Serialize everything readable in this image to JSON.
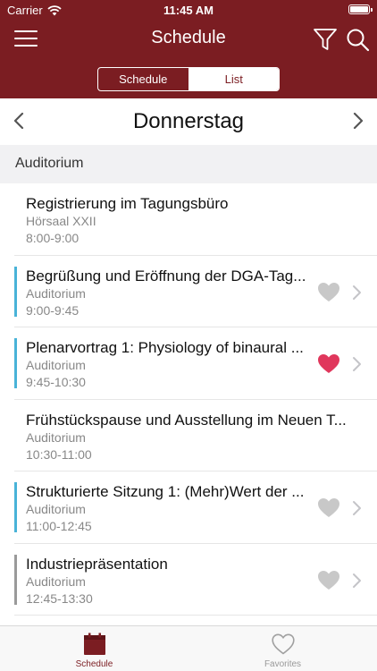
{
  "status_bar": {
    "carrier": "Carrier",
    "time": "11:45 AM"
  },
  "nav": {
    "title": "Schedule"
  },
  "segments": [
    {
      "label": "Schedule"
    },
    {
      "label": "List"
    }
  ],
  "day": {
    "title": "Donnerstag"
  },
  "section": {
    "title": "Auditorium"
  },
  "colors": {
    "brand": "#7b1d22",
    "accent_blue": "#49b3d8",
    "heart_gray": "#c8c8c8",
    "heart_red": "#e0375c",
    "bar_gray": "#9a9a9a"
  },
  "events": [
    {
      "title": "Registrierung im Tagungsbüro",
      "room": "Hörsaal XXII",
      "time": "8:00-9:00"
    },
    {
      "title": "Begrüßung und Eröffnung der DGA-Tag...",
      "room": "Auditorium",
      "time": "9:00-9:45",
      "favorite": false
    },
    {
      "title": "Plenarvortrag 1: Physiology of binaural ...",
      "room": "Auditorium",
      "time": "9:45-10:30",
      "favorite": true
    },
    {
      "title": "Frühstückspause und Ausstellung im Neuen T...",
      "room": "Auditorium",
      "time": "10:30-11:00"
    },
    {
      "title": "Strukturierte Sitzung 1: (Mehr)Wert der ...",
      "room": "Auditorium",
      "time": "11:00-12:45",
      "favorite": false
    },
    {
      "title": "Industriepräsentation",
      "room": "Auditorium",
      "time": "12:45-13:30",
      "favorite": false
    }
  ],
  "tabs": [
    {
      "label": "Schedule",
      "icon": "calendar-icon"
    },
    {
      "label": "Favorites",
      "icon": "heart-icon"
    }
  ]
}
